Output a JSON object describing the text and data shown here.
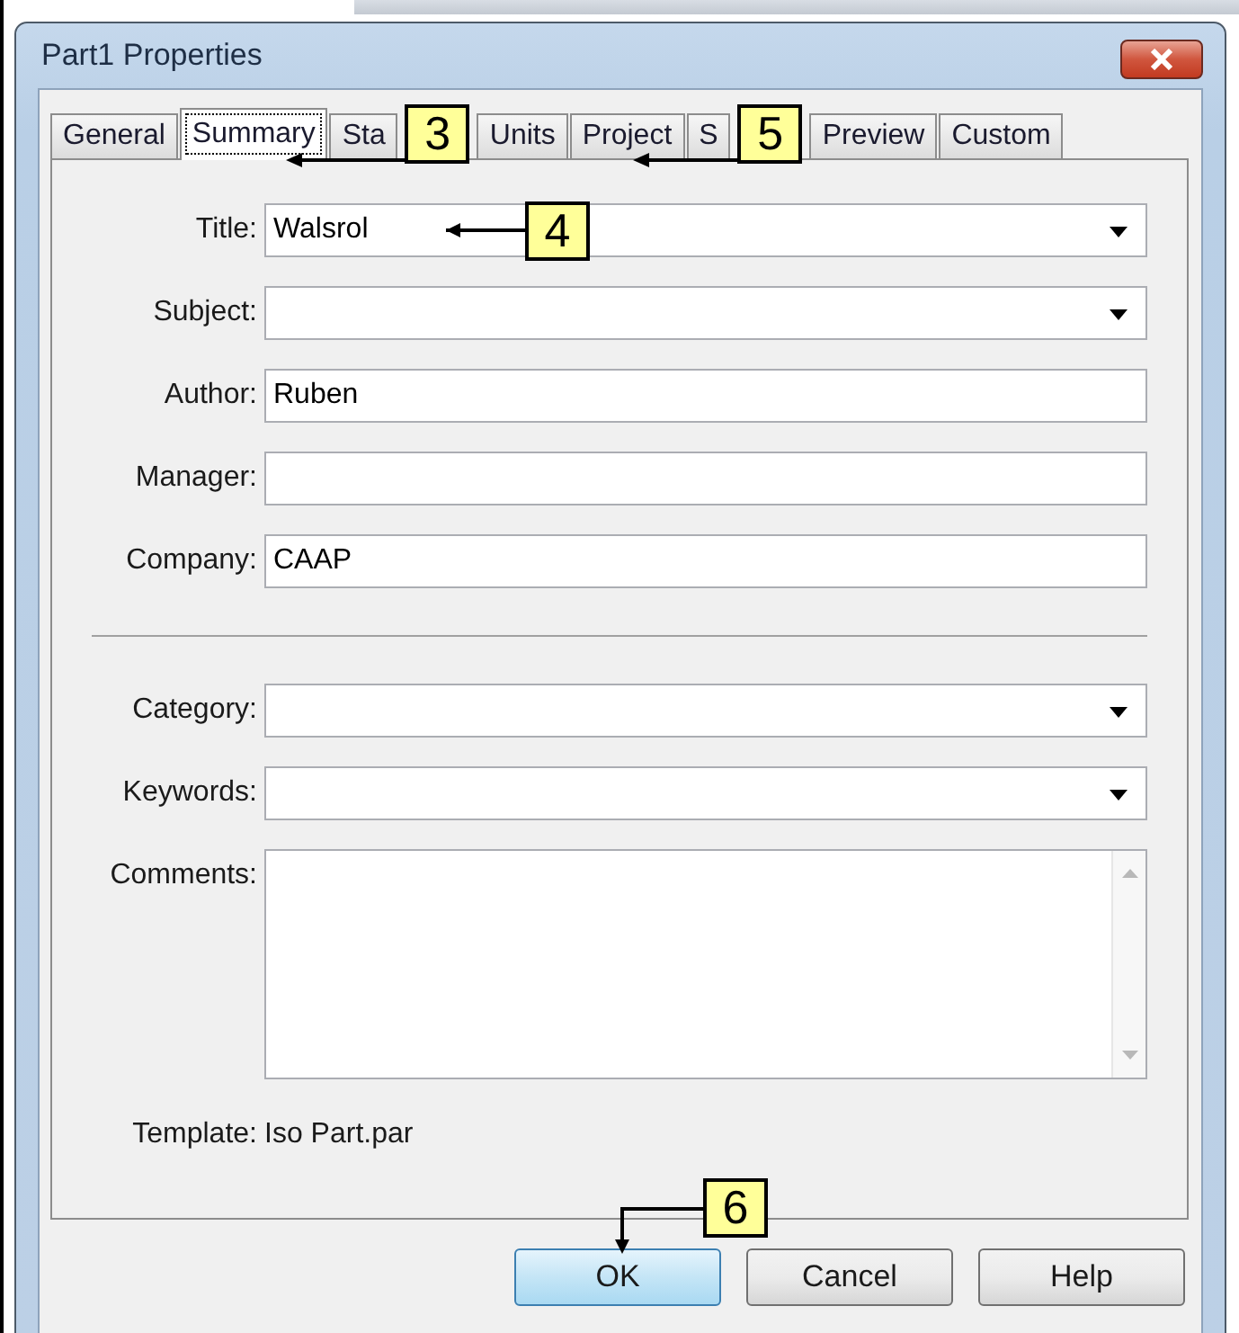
{
  "window": {
    "title": "Part1 Properties"
  },
  "tabs": [
    {
      "label": "General",
      "selected": false
    },
    {
      "label": "Summary",
      "selected": true
    },
    {
      "label": "Sta",
      "selected": false
    },
    {
      "label": "Units",
      "selected": false
    },
    {
      "label": "Project",
      "selected": false
    },
    {
      "label": "S",
      "selected": false
    },
    {
      "label": "Preview",
      "selected": false
    },
    {
      "label": "Custom",
      "selected": false
    }
  ],
  "upper_fields": [
    {
      "label": "Title:",
      "value": "Walsrol",
      "kind": "dropdown"
    },
    {
      "label": "Subject:",
      "kind": "dropdown"
    },
    {
      "label": "Author:",
      "value": "Ruben",
      "kind": "text"
    },
    {
      "label": "Manager:",
      "kind": "text"
    },
    {
      "label": "Company:",
      "value": "CAAP",
      "kind": "text"
    }
  ],
  "lower_fields": [
    {
      "label": "Category:",
      "kind": "dropdown"
    },
    {
      "label": "Keywords:",
      "kind": "dropdown"
    }
  ],
  "comments": {
    "label": "Comments:"
  },
  "template": {
    "label": "Template:",
    "value": "Iso Part.par"
  },
  "buttons": [
    {
      "label": "OK",
      "default": true
    },
    {
      "label": "Cancel",
      "default": false
    },
    {
      "label": "Help",
      "default": false
    }
  ],
  "callouts": [
    {
      "number": "3"
    },
    {
      "number": "5"
    },
    {
      "number": "4"
    },
    {
      "number": "6"
    }
  ]
}
